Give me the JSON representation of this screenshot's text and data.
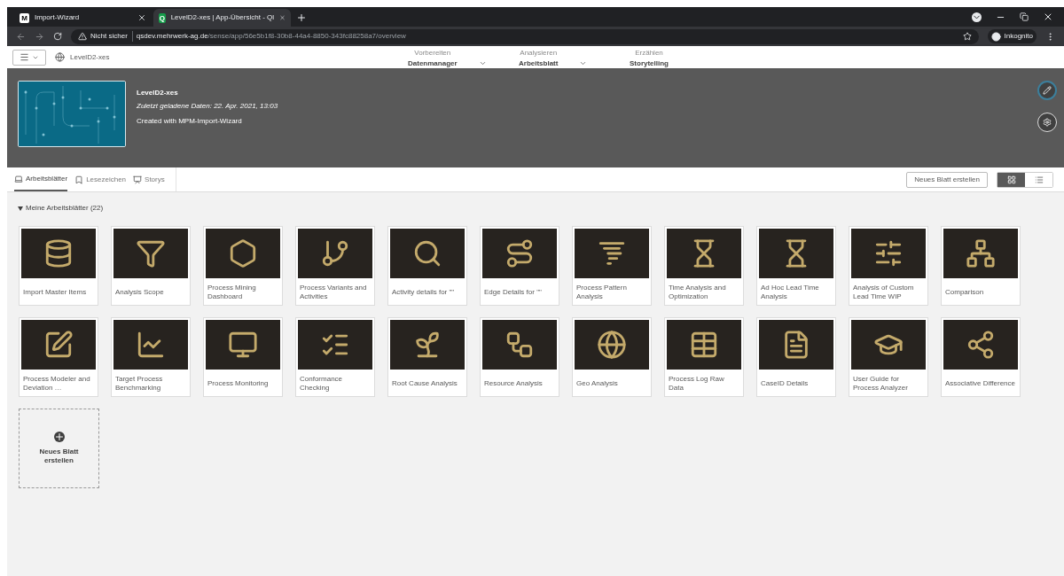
{
  "browser": {
    "tabs": [
      {
        "label": "Import-Wizard",
        "badge": "M",
        "selected": false
      },
      {
        "label": "LevelD2-xes | App-Übersicht - Ql",
        "badge": "Q",
        "selected": true
      }
    ],
    "security": "Nicht sicher",
    "url_host": "qsdev.mehrwerk-ag.de",
    "url_path": "/sense/app/56e5b1f8-30b8-44a4-8850-343fc88258a7/overview",
    "profile": "Inkognito"
  },
  "toolbar": {
    "app_name": "LevelD2-xes",
    "nav": [
      {
        "caption": "Vorbereiten",
        "label": "Datenmanager",
        "dropdown": true
      },
      {
        "caption": "Analysieren",
        "label": "Arbeitsblatt",
        "dropdown": true
      },
      {
        "caption": "Erzählen",
        "label": "Storytelling",
        "dropdown": false
      }
    ]
  },
  "app": {
    "title": "LevelD2-xes",
    "loaded": "Zuletzt geladene Daten: 22. Apr. 2021, 13:03",
    "description": "Created with MPM-Import-Wizard"
  },
  "tabs": [
    {
      "label": "Arbeitsblätter",
      "selected": true
    },
    {
      "label": "Lesezeichen",
      "selected": false
    },
    {
      "label": "Storys",
      "selected": false
    }
  ],
  "new_sheet_button": "Neues Blatt erstellen",
  "views": [
    {
      "kind": "grid",
      "selected": true
    },
    {
      "kind": "list",
      "selected": false
    }
  ],
  "section": {
    "title": "Meine Arbeitsblätter (22)",
    "expanded": true
  },
  "sheets": [
    {
      "title": "Import Master Items"
    },
    {
      "title": "Analysis Scope"
    },
    {
      "title": "Process Mining Dashboard"
    },
    {
      "title": "Process Variants and Activities"
    },
    {
      "title": "Activity details for \"\""
    },
    {
      "title": "Edge Details for \"\""
    },
    {
      "title": "Process Pattern Analysis"
    },
    {
      "title": "Time Analysis and Optimization"
    },
    {
      "title": "Ad Hoc Lead Time Analysis"
    },
    {
      "title": "Analysis of Custom Lead Time WIP"
    },
    {
      "title": "Comparison"
    },
    {
      "title": "Process Modeler and Deviation …"
    },
    {
      "title": "Target Process Benchmarking"
    },
    {
      "title": "Process Monitoring"
    },
    {
      "title": "Conformance Checking"
    },
    {
      "title": "Root Cause Analysis"
    },
    {
      "title": "Resource Analysis"
    },
    {
      "title": "Geo Analysis"
    },
    {
      "title": "Process Log Raw Data"
    },
    {
      "title": "CaseID Details"
    },
    {
      "title": "User Guide for Process Analyzer"
    },
    {
      "title": "Associative Difference"
    }
  ],
  "create_tile": "Neues Blatt erstellen"
}
